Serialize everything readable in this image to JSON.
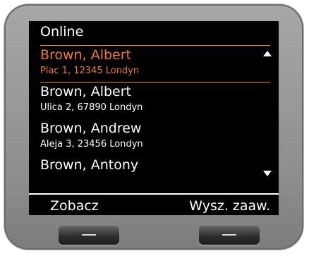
{
  "screen": {
    "title": "Online",
    "contacts": [
      {
        "name": "Brown, Albert",
        "address": "Plac 1, 12345 Londyn",
        "selected": true
      },
      {
        "name": "Brown, Albert",
        "address": "Ulica 2, 67890 Londyn",
        "selected": false
      },
      {
        "name": "Brown, Andrew",
        "address": "Aleja 3, 23456 Londyn",
        "selected": false
      },
      {
        "name": "Brown, Antony",
        "address": "",
        "selected": false
      }
    ],
    "softkeys": {
      "left": "Zobacz",
      "right": "Wysz. zaaw."
    }
  },
  "colors": {
    "highlight": "#f07a2d",
    "screen_bg": "#000000",
    "bezel": "#9a9a9a"
  },
  "icons": {
    "scroll_up": "triangle-up-icon",
    "scroll_down": "triangle-down-icon",
    "key_mark": "dash-icon"
  }
}
